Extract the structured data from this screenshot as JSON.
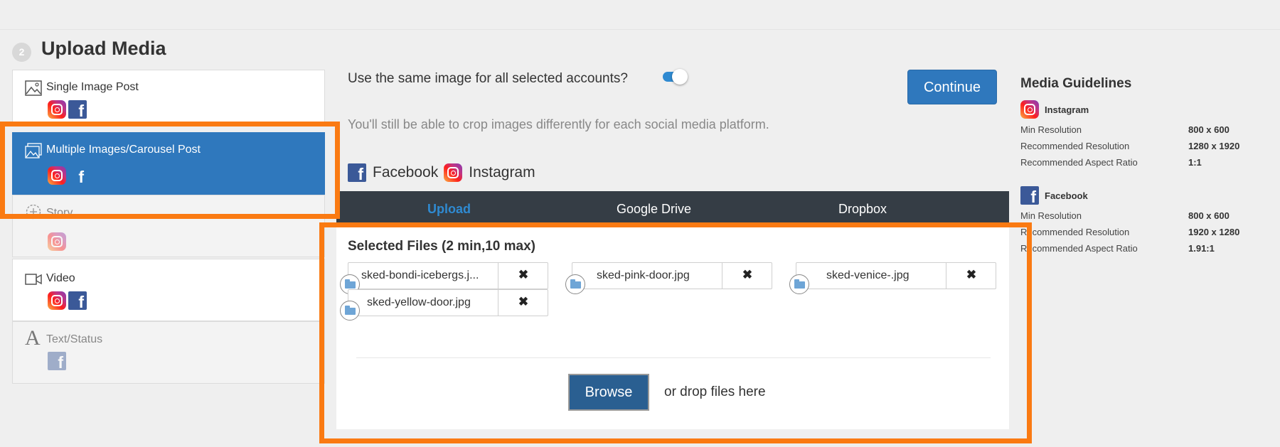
{
  "header": {
    "step_number": "2",
    "title": "Upload Media"
  },
  "post_types": [
    {
      "label": "Single Image Post",
      "icon": "image-icon",
      "networks": [
        "instagram",
        "facebook"
      ],
      "state": "normal"
    },
    {
      "label": "Multiple Images/Carousel Post",
      "icon": "images-icon",
      "networks": [
        "instagram",
        "facebook"
      ],
      "state": "selected"
    },
    {
      "label": "Story",
      "icon": "story-icon",
      "networks": [
        "instagram"
      ],
      "state": "disabled"
    },
    {
      "label": "Video",
      "icon": "video-icon",
      "networks": [
        "instagram",
        "facebook"
      ],
      "state": "normal"
    },
    {
      "label": "Text/Status",
      "icon": "text-icon",
      "networks": [
        "facebook"
      ],
      "state": "disabled"
    }
  ],
  "options": {
    "same_image_question": "Use the same image for all selected accounts?",
    "same_image_toggle_on": true,
    "crop_note": "You'll still be able to crop images differently for each social media platform.",
    "continue_label": "Continue"
  },
  "accounts": [
    {
      "network": "facebook",
      "label": "Facebook"
    },
    {
      "network": "instagram",
      "label": "Instagram"
    }
  ],
  "source_tabs": [
    {
      "label": "Upload",
      "active": true
    },
    {
      "label": "Google Drive",
      "active": false
    },
    {
      "label": "Dropbox",
      "active": false
    }
  ],
  "dropzone": {
    "selected_title": "Selected Files (2 min,10 max)",
    "files": [
      {
        "name": "sked-bondi-icebergs.j..."
      },
      {
        "name": "sked-pink-door.jpg"
      },
      {
        "name": "sked-venice-.jpg"
      },
      {
        "name": "sked-yellow-door.jpg"
      }
    ],
    "remove_symbol": "✖",
    "browse_label": "Browse",
    "drop_text": "or drop files here"
  },
  "guidelines": {
    "title": "Media Guidelines",
    "networks": [
      {
        "name": "Instagram",
        "rows": [
          {
            "label": "Min Resolution",
            "value": "800 x 600"
          },
          {
            "label": "Recommended Resolution",
            "value": "1280 x 1920"
          },
          {
            "label": "Recommended Aspect Ratio",
            "value": "1:1"
          }
        ]
      },
      {
        "name": "Facebook",
        "rows": [
          {
            "label": "Min Resolution",
            "value": "800 x 600"
          },
          {
            "label": "Recommended Resolution",
            "value": "1920 x 1280"
          },
          {
            "label": "Recommended Aspect Ratio",
            "value": "1.91:1"
          }
        ]
      }
    ]
  },
  "colors": {
    "accent": "#2f78bd",
    "highlight": "#fa7a12",
    "tab_bar": "#353d45"
  }
}
